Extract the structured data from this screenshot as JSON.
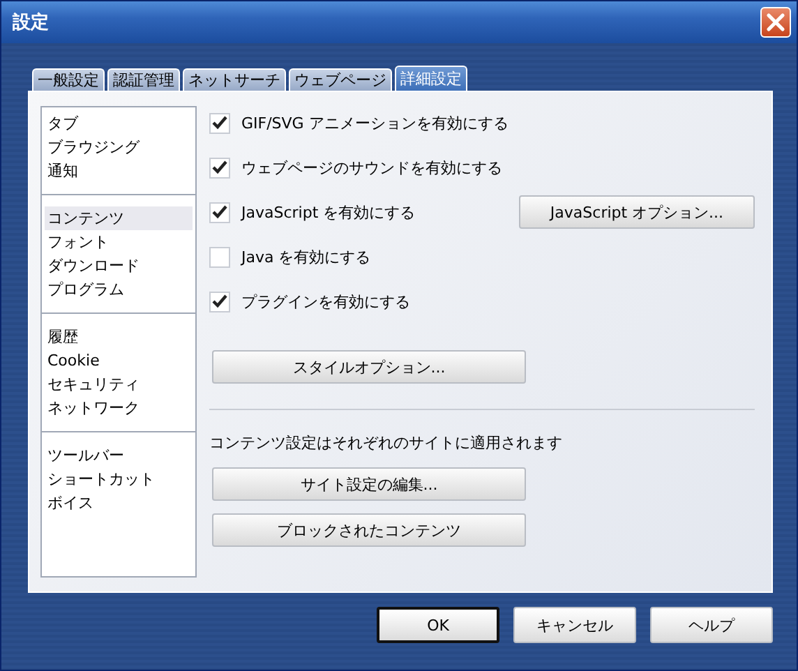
{
  "window": {
    "title": "設定"
  },
  "tabs": [
    {
      "label": "一般設定",
      "selected": false
    },
    {
      "label": "認証管理",
      "selected": false
    },
    {
      "label": "ネットサーチ",
      "selected": false
    },
    {
      "label": "ウェブページ",
      "selected": false
    },
    {
      "label": "詳細設定",
      "selected": true
    }
  ],
  "sidebar": {
    "groups": [
      {
        "items": [
          {
            "label": "タブ",
            "selected": false
          },
          {
            "label": "ブラウジング",
            "selected": false
          },
          {
            "label": "通知",
            "selected": false
          }
        ]
      },
      {
        "items": [
          {
            "label": "コンテンツ",
            "selected": true
          },
          {
            "label": "フォント",
            "selected": false
          },
          {
            "label": "ダウンロード",
            "selected": false
          },
          {
            "label": "プログラム",
            "selected": false
          }
        ]
      },
      {
        "items": [
          {
            "label": "履歴",
            "selected": false
          },
          {
            "label": "Cookie",
            "selected": false
          },
          {
            "label": "セキュリティ",
            "selected": false
          },
          {
            "label": "ネットワーク",
            "selected": false
          }
        ]
      },
      {
        "items": [
          {
            "label": "ツールバー",
            "selected": false
          },
          {
            "label": "ショートカット",
            "selected": false
          },
          {
            "label": "ボイス",
            "selected": false
          }
        ]
      }
    ]
  },
  "options": [
    {
      "label": "GIF/SVG アニメーションを有効にする",
      "checked": true
    },
    {
      "label": "ウェブページのサウンドを有効にする",
      "checked": true
    },
    {
      "label": "JavaScript を有効にする",
      "checked": true,
      "button": "JavaScript オプション..."
    },
    {
      "label": "Java を有効にする",
      "checked": false
    },
    {
      "label": "プラグインを有効にする",
      "checked": true
    }
  ],
  "style_button": "スタイルオプション...",
  "site_note": "コンテンツ設定はそれぞれのサイトに適用されます",
  "site_buttons": [
    "サイト設定の編集...",
    "ブロックされたコンテンツ"
  ],
  "buttons": [
    {
      "label": "OK",
      "default": true
    },
    {
      "label": "キャンセル",
      "default": false
    },
    {
      "label": "ヘルプ",
      "default": false
    }
  ]
}
